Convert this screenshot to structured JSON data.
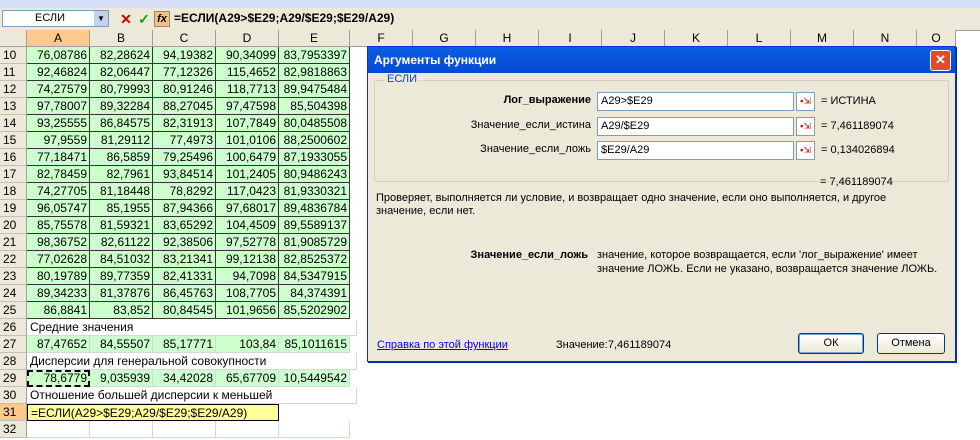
{
  "formula_bar": {
    "name_box": "ЕСЛИ",
    "cancel_glyph": "✕",
    "enter_glyph": "✓",
    "fx_glyph": "fx",
    "formula": "=ЕСЛИ(A29>$E29;A29/$E29;$E29/A29)"
  },
  "columns": [
    "A",
    "B",
    "C",
    "D",
    "E",
    "F",
    "G",
    "H",
    "I",
    "J",
    "K",
    "L",
    "M",
    "N",
    "O"
  ],
  "rows": [
    {
      "n": "10",
      "v": [
        "76,08786",
        "82,28624",
        "94,19382",
        "90,34099",
        "83,7953397"
      ]
    },
    {
      "n": "11",
      "v": [
        "92,46824",
        "82,06447",
        "77,12326",
        "115,4652",
        "82,9818863"
      ]
    },
    {
      "n": "12",
      "v": [
        "74,27579",
        "80,79993",
        "80,91246",
        "118,7713",
        "89,9475484"
      ]
    },
    {
      "n": "13",
      "v": [
        "97,78007",
        "89,32284",
        "88,27045",
        "97,47598",
        "85,504398"
      ]
    },
    {
      "n": "14",
      "v": [
        "93,25555",
        "86,84575",
        "82,31913",
        "107,7849",
        "80,0485508"
      ]
    },
    {
      "n": "15",
      "v": [
        "97,9559",
        "81,29112",
        "77,4973",
        "101,0106",
        "88,2500602"
      ]
    },
    {
      "n": "16",
      "v": [
        "77,18471",
        "86,5859",
        "79,25496",
        "100,6479",
        "87,1933055"
      ]
    },
    {
      "n": "17",
      "v": [
        "82,78459",
        "82,7961",
        "93,84514",
        "101,2405",
        "80,9486243"
      ]
    },
    {
      "n": "18",
      "v": [
        "74,27705",
        "81,18448",
        "78,8292",
        "117,0423",
        "81,9330321"
      ]
    },
    {
      "n": "19",
      "v": [
        "96,05747",
        "85,1955",
        "87,94366",
        "97,68017",
        "89,4836784"
      ]
    },
    {
      "n": "20",
      "v": [
        "85,75578",
        "81,59321",
        "83,65292",
        "104,4509",
        "89,5589137"
      ]
    },
    {
      "n": "21",
      "v": [
        "98,36752",
        "82,61122",
        "92,38506",
        "97,52778",
        "81,9085729"
      ]
    },
    {
      "n": "22",
      "v": [
        "77,02628",
        "84,51032",
        "83,21341",
        "99,12138",
        "82,8525372"
      ]
    },
    {
      "n": "23",
      "v": [
        "80,19789",
        "89,77359",
        "82,41331",
        "94,7098",
        "84,5347915"
      ]
    },
    {
      "n": "24",
      "v": [
        "89,34233",
        "81,37876",
        "86,45763",
        "108,7705",
        "84,374391"
      ]
    },
    {
      "n": "25",
      "v": [
        "86,8841",
        "83,852",
        "80,84545",
        "101,9656",
        "85,5202902"
      ]
    }
  ],
  "row26": {
    "n": "26",
    "text": "Средние значения"
  },
  "row27": {
    "n": "27",
    "v": [
      "87,47652",
      "84,55507",
      "85,17771",
      "103,84",
      "85,1011615"
    ]
  },
  "row28": {
    "n": "28",
    "text": "Дисперсии для генеральной совокупности"
  },
  "row29": {
    "n": "29",
    "v": [
      "78,6779",
      "9,035939",
      "34,42028",
      "65,67709",
      "10,5449542"
    ]
  },
  "row30": {
    "n": "30",
    "text": "Отношение большей дисперсии к меньшей"
  },
  "row31": {
    "n": "31",
    "text": "=ЕСЛИ(A29>$E29;A29/$E29;$E29/A29)"
  },
  "row32": {
    "n": "32"
  },
  "dialog": {
    "title": "Аргументы функции",
    "close_glyph": "✕",
    "function_name": "ЕСЛИ",
    "args": [
      {
        "label": "Лог_выражение",
        "value": "A29>$E29",
        "result": "= ИСТИНА"
      },
      {
        "label": "Значение_если_истина",
        "value": "A29/$E29",
        "result": "= 7,461189074"
      },
      {
        "label": "Значение_если_ложь",
        "value": "$E29/A29",
        "result": "= 0,134026894"
      }
    ],
    "ref_glyph": "▪⇲",
    "total_result": "= 7,461189074",
    "description": "Проверяет, выполняется ли условие, и возвращает одно значение, если оно выполняется, и другое значение, если нет.",
    "arg_help_name": "Значение_если_ложь",
    "arg_help_line1": "значение, которое возвращается, если 'лог_выражение' имеет",
    "arg_help_line2": "значение ЛОЖЬ. Если не указано, возвращается значение ЛОЖЬ.",
    "help_link": "Справка по этой функции",
    "value_label": "Значение:",
    "value": "7,461189074",
    "ok_label": "ОК",
    "cancel_label": "Отмена"
  }
}
